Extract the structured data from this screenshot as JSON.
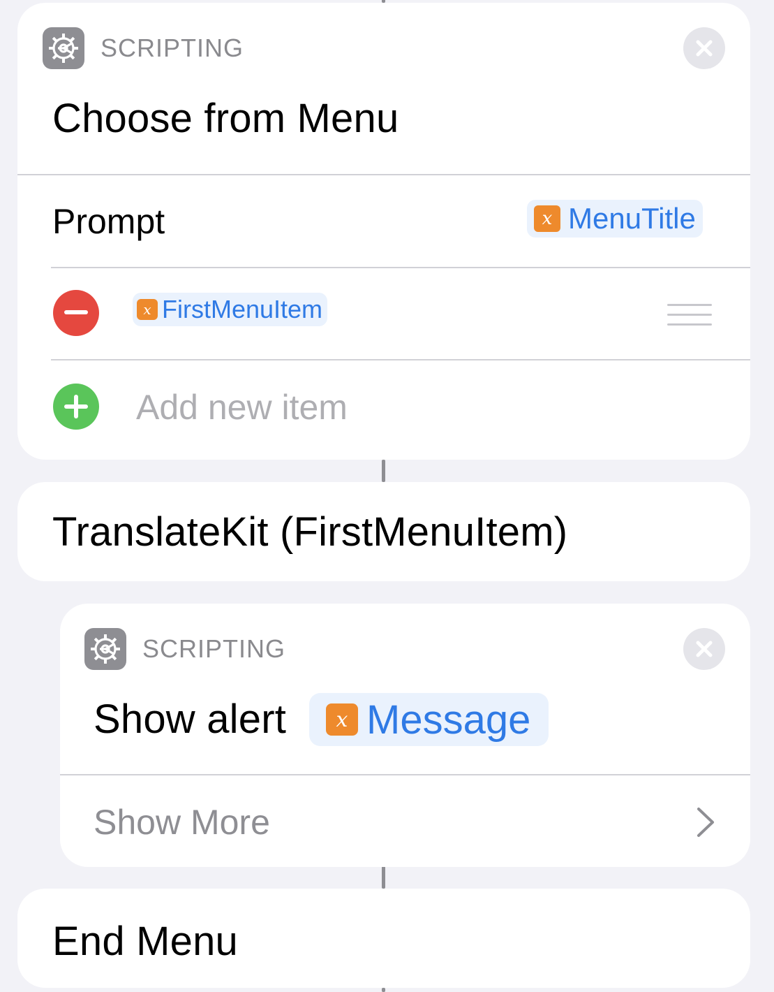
{
  "choose_menu": {
    "category": "SCRIPTING",
    "app_icon": "gear-icon",
    "title": "Choose from Menu",
    "prompt_label": "Prompt",
    "prompt_variable": "MenuTitle",
    "items": [
      {
        "variable": "FirstMenuItem"
      }
    ],
    "add_item_placeholder": "Add new item"
  },
  "menu_case": {
    "title": "TranslateKit (FirstMenuItem)"
  },
  "show_alert": {
    "category": "SCRIPTING",
    "app_icon": "gear-icon",
    "title": "Show alert",
    "variable": "Message",
    "show_more_label": "Show More"
  },
  "end_menu": {
    "title": "End Menu"
  },
  "variable_badge_glyph": "x",
  "colors": {
    "background": "#f2f2f7",
    "card": "#ffffff",
    "variable_blue": "#2f7ae5",
    "variable_badge": "#ee8a2c",
    "remove_red": "#e5483f",
    "add_green": "#5ac55a",
    "scripting_gray": "#8e8e93"
  }
}
